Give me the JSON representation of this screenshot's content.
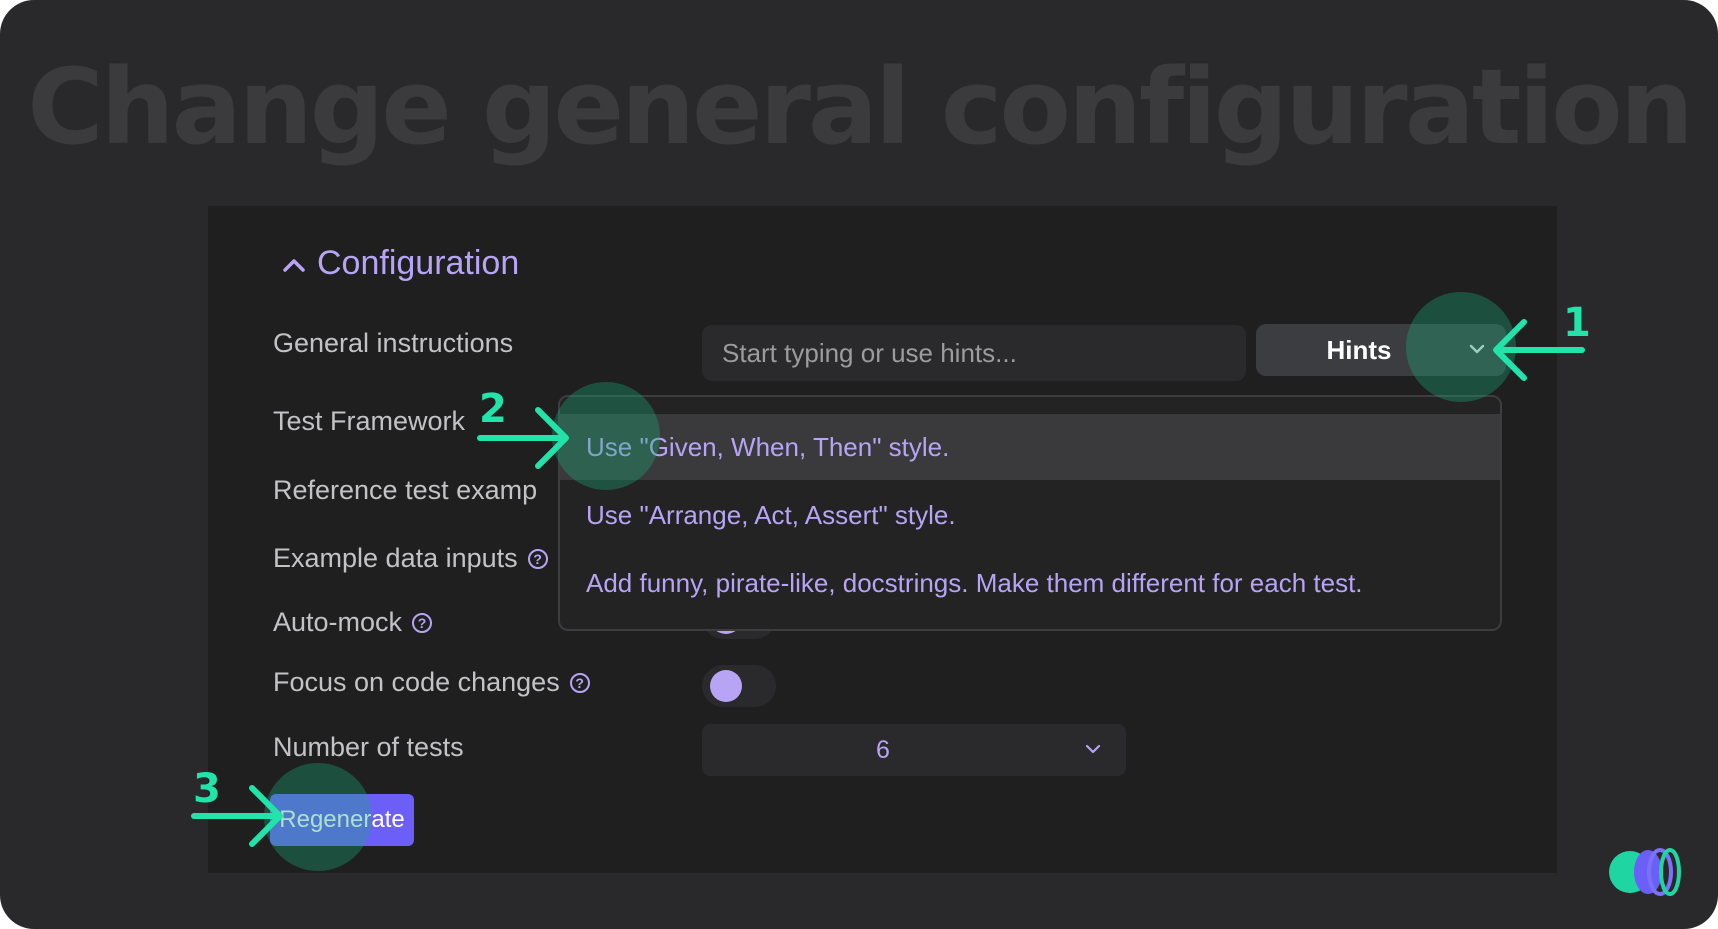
{
  "heading": "Change general configuration",
  "configuration": {
    "section_title": "Configuration",
    "labels": {
      "general_instructions": "General instructions",
      "test_framework": "Test Framework",
      "reference_test_example": "Reference test examp",
      "example_data_inputs": "Example data inputs",
      "auto_mock": "Auto-mock",
      "focus_on_code_changes": "Focus on code changes",
      "number_of_tests": "Number of tests"
    },
    "instructions_placeholder": "Start typing or use hints...",
    "hints_label": "Hints",
    "number_of_tests_value": "6",
    "regenerate_label": "Regenerate",
    "help_glyph": "?",
    "toggles": {
      "auto_mock": true,
      "focus_on_code_changes": true
    }
  },
  "hints_menu": {
    "items": [
      "Use \"Given, When, Then\" style.",
      "Use \"Arrange, Act, Assert\" style.",
      "Add funny, pirate-like, docstrings. Make them different for each test."
    ],
    "selected_index": 0
  },
  "steps": [
    "1",
    "2",
    "3"
  ],
  "colors": {
    "background": "#29292b",
    "panel": "#1f1f20",
    "accent": "#b7a4f5",
    "button": "#6b5ff7",
    "annotation": "#22e4aa"
  }
}
